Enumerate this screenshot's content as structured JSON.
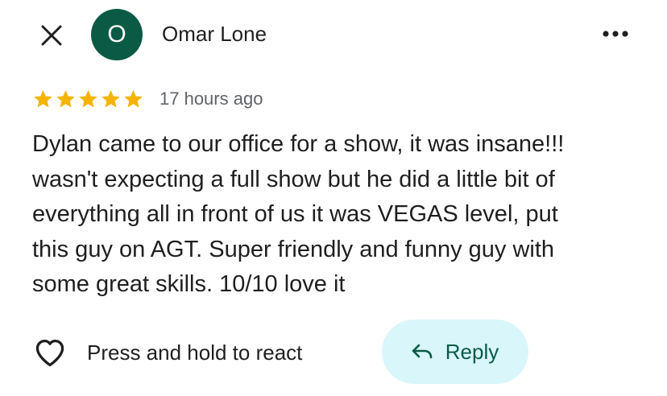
{
  "header": {
    "close_icon": "close-icon",
    "avatar_letter": "O",
    "avatar_color": "#0b5a45",
    "author_name": "Omar Lone",
    "more_icon": "more-options-icon"
  },
  "review": {
    "rating": 5,
    "rating_max": 5,
    "star_color": "#f5b400",
    "time_ago": "17 hours ago",
    "text": "Dylan came to our office for a show, it was insane!!!\nwasn't expecting a full show but he did a little bit of\neverything all in front of us it was VEGAS level, put\nthis guy on AGT. Super friendly and funny guy with\nsome great skills. 10/10 love it"
  },
  "actions": {
    "react_label": "Press and hold to react",
    "react_icon": "heart-outline-icon",
    "reply_label": "Reply",
    "reply_icon": "reply-arrow-icon",
    "reply_bg": "#d9f6fb",
    "reply_fg": "#0b5a45"
  }
}
